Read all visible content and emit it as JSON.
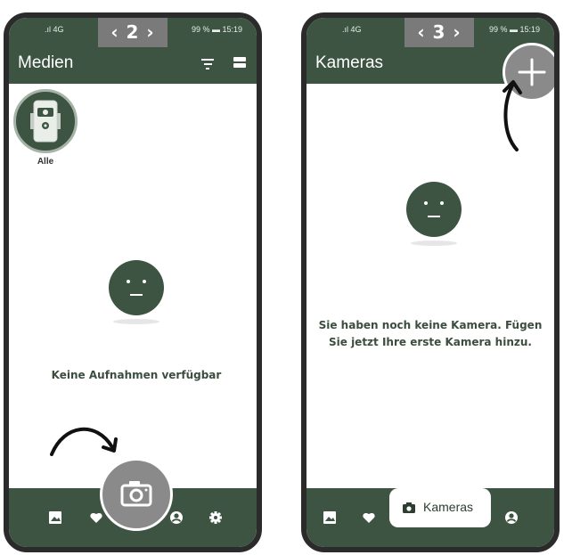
{
  "left_phone": {
    "step_badge": "‹ 2 ›",
    "status": {
      "signal": ".ıl 4G",
      "battery": "99 % ▬ 15:19"
    },
    "title": "Medien",
    "all_label": "Alle",
    "empty_message": "Keine Aufnahmen verfügbar",
    "nav": [
      "image-icon",
      "heart-icon",
      "camera-icon",
      "account-icon",
      "settings-icon"
    ]
  },
  "right_phone": {
    "step_badge": "‹ 3 ›",
    "status": {
      "signal": ".ıl 4G",
      "battery": "99 % ▬ 15:19"
    },
    "title": "Kameras",
    "empty_message_line1": "Sie haben noch keine Kamera. Fügen",
    "empty_message_line2": "Sie jetzt Ihre erste Kamera hinzu.",
    "active_tab_label": "Kameras",
    "nav": [
      "image-icon",
      "heart-icon",
      "camera-icon",
      "account-icon"
    ]
  },
  "colors": {
    "primary": "#3c5441",
    "fab_gray": "#8a8a8a",
    "badge_gray": "#7a7a7a"
  }
}
